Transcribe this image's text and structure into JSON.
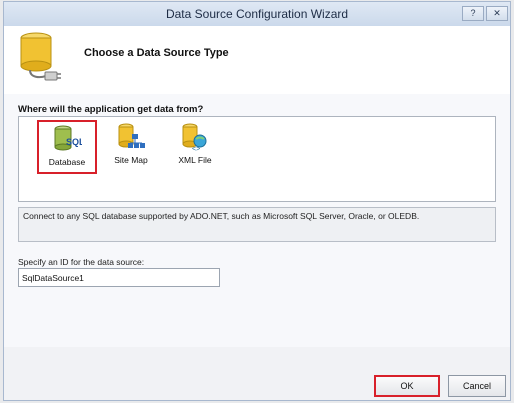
{
  "window": {
    "title": "Data Source Configuration Wizard",
    "help_button": "?",
    "close_button": "✕"
  },
  "header": {
    "title": "Choose a Data Source Type",
    "icon": "database-plug-icon"
  },
  "sources": {
    "question": "Where will the application get data from?",
    "items": [
      {
        "label": "Database",
        "icon": "sql-database-icon",
        "selected": true
      },
      {
        "label": "Site Map",
        "icon": "site-map-icon",
        "selected": false
      },
      {
        "label": "XML File",
        "icon": "xml-file-icon",
        "selected": false
      }
    ]
  },
  "description": "Connect to any SQL database supported by ADO.NET, such as Microsoft SQL Server, Oracle, or OLEDB.",
  "id_field": {
    "label": "Specify an ID for the data source:",
    "value": "SqlDataSource1"
  },
  "buttons": {
    "ok": "OK",
    "cancel": "Cancel"
  },
  "colors": {
    "selection_highlight": "#d8202a",
    "database_yellow": "#f1c232"
  }
}
